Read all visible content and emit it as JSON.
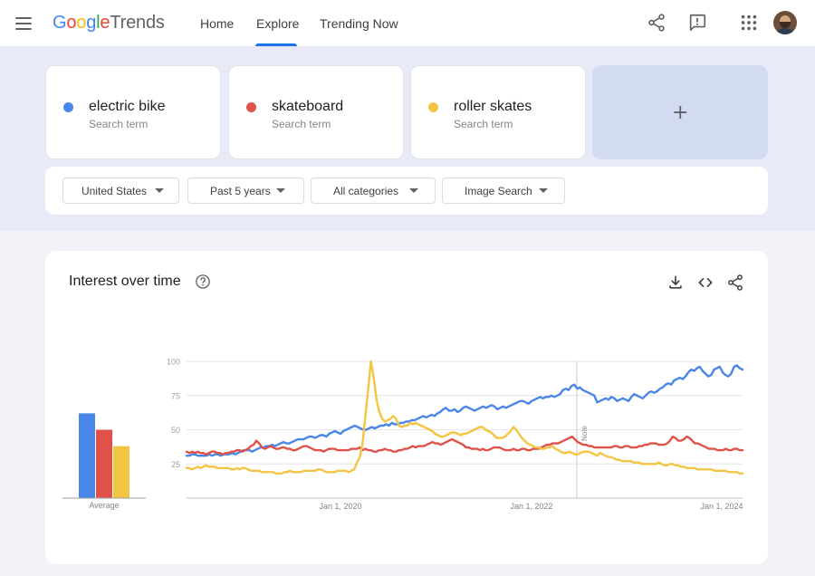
{
  "header": {
    "logo": {
      "g": "G",
      "o1": "o",
      "o2": "o",
      "g2": "g",
      "l": "l",
      "e": "e",
      "trends": "Trends"
    },
    "nav": [
      "Home",
      "Explore",
      "Trending Now"
    ],
    "active_tab": "Explore",
    "icons": [
      "menu-icon",
      "share-icon",
      "feedback-icon",
      "apps-grid-icon",
      "avatar"
    ]
  },
  "terms": [
    {
      "name": "electric bike",
      "sub": "Search term",
      "color": "#4a86e8"
    },
    {
      "name": "skateboard",
      "sub": "Search term",
      "color": "#e0514a"
    },
    {
      "name": "roller skates",
      "sub": "Search term",
      "color": "#f4c542"
    }
  ],
  "add_card": {
    "label": "+"
  },
  "filters": [
    "United States",
    "Past 5 years",
    "All categories",
    "Image Search"
  ],
  "main": {
    "title": "Interest over time",
    "icons": [
      "help-icon",
      "download-icon",
      "embed-code-icon",
      "share-icon"
    ]
  },
  "average": {
    "label": "Average",
    "values": [
      62,
      50,
      38
    ]
  },
  "chart_data": {
    "type": "line",
    "ylim": [
      0,
      100
    ],
    "y_ticks": [
      25,
      50,
      75,
      100
    ],
    "x_ticks": [
      "Jan 1, 2020",
      "Jan 1, 2022",
      "Jan 1, 2024"
    ],
    "note": "Note",
    "series": [
      {
        "name": "electric bike",
        "color": "#4a86e8",
        "values": [
          31,
          31,
          32,
          32,
          31,
          31,
          31,
          31,
          32,
          31,
          32,
          32,
          31,
          32,
          32,
          32,
          33,
          32,
          33,
          34,
          35,
          35,
          35,
          34,
          35,
          36,
          37,
          37,
          38,
          38,
          39,
          38,
          39,
          40,
          41,
          40,
          40,
          41,
          42,
          43,
          43,
          43,
          44,
          45,
          45,
          44,
          45,
          46,
          46,
          45,
          47,
          48,
          49,
          48,
          47,
          49,
          50,
          51,
          52,
          53,
          52,
          51,
          50,
          50,
          51,
          52,
          51,
          52,
          53,
          53,
          54,
          53,
          55,
          54,
          54,
          55,
          55,
          56,
          56,
          57,
          57,
          58,
          59,
          60,
          59,
          60,
          61,
          60,
          62,
          63,
          65,
          66,
          64,
          64,
          65,
          63,
          64,
          66,
          67,
          66,
          65,
          64,
          65,
          66,
          67,
          66,
          67,
          68,
          67,
          65,
          66,
          67,
          66,
          67,
          68,
          69,
          70,
          71,
          71,
          70,
          69,
          71,
          72,
          73,
          74,
          73,
          74,
          74,
          75,
          74,
          75,
          76,
          79,
          80,
          79,
          82,
          83,
          80,
          81,
          79,
          78,
          77,
          76,
          75,
          70,
          71,
          72,
          73,
          72,
          74,
          73,
          71,
          72,
          73,
          72,
          71,
          74,
          76,
          75,
          74,
          73,
          75,
          77,
          78,
          77,
          78,
          80,
          81,
          83,
          84,
          83,
          86,
          87,
          88,
          87,
          89,
          92,
          94,
          93,
          95,
          96,
          93,
          91,
          89,
          90,
          94,
          95,
          96,
          92,
          90,
          89,
          91,
          96,
          97,
          95,
          94
        ]
      },
      {
        "name": "skateboard",
        "color": "#e0514a",
        "values": [
          34,
          33,
          34,
          33,
          34,
          33,
          33,
          32,
          33,
          34,
          34,
          33,
          33,
          32,
          33,
          33,
          34,
          34,
          35,
          35,
          34,
          35,
          36,
          38,
          39,
          42,
          40,
          37,
          36,
          37,
          38,
          37,
          36,
          36,
          37,
          37,
          36,
          36,
          35,
          35,
          36,
          37,
          38,
          38,
          37,
          36,
          35,
          35,
          35,
          34,
          35,
          36,
          36,
          36,
          35,
          35,
          35,
          35,
          35,
          36,
          36,
          36,
          37,
          35,
          36,
          35,
          35,
          34,
          34,
          35,
          35,
          36,
          35,
          35,
          34,
          34,
          35,
          35,
          36,
          36,
          37,
          38,
          37,
          38,
          38,
          38,
          39,
          40,
          41,
          40,
          40,
          39,
          40,
          41,
          42,
          43,
          42,
          41,
          40,
          39,
          37,
          37,
          36,
          36,
          36,
          35,
          36,
          35,
          35,
          36,
          37,
          37,
          37,
          36,
          35,
          35,
          35,
          36,
          35,
          35,
          36,
          36,
          35,
          35,
          36,
          36,
          36,
          37,
          38,
          39,
          39,
          40,
          40,
          40,
          41,
          42,
          43,
          44,
          45,
          43,
          41,
          40,
          39,
          39,
          38,
          38,
          37,
          37,
          37,
          37,
          37,
          37,
          37,
          38,
          38,
          37,
          37,
          38,
          38,
          37,
          37,
          37,
          38,
          38,
          39,
          39,
          40,
          40,
          40,
          39,
          39,
          39,
          40,
          42,
          45,
          44,
          42,
          42,
          43,
          45,
          44,
          42,
          40,
          40,
          39,
          38,
          37,
          36,
          36,
          36,
          35,
          35,
          35,
          36,
          35,
          35,
          36,
          36,
          35,
          35
        ]
      },
      {
        "name": "roller skates",
        "color": "#f4c542",
        "values": [
          22,
          22,
          21,
          22,
          23,
          22,
          23,
          24,
          23,
          23,
          23,
          22,
          22,
          22,
          22,
          22,
          21,
          21,
          22,
          21,
          22,
          22,
          21,
          20,
          20,
          20,
          20,
          19,
          19,
          19,
          19,
          19,
          18,
          18,
          18,
          19,
          19,
          20,
          19,
          19,
          19,
          19,
          20,
          20,
          20,
          20,
          20,
          21,
          21,
          20,
          19,
          19,
          19,
          19,
          20,
          20,
          20,
          20,
          19,
          20,
          21,
          26,
          30,
          40,
          60,
          80,
          100,
          88,
          72,
          63,
          58,
          56,
          57,
          58,
          60,
          58,
          53,
          52,
          53,
          53,
          55,
          54,
          55,
          54,
          53,
          52,
          51,
          50,
          49,
          47,
          46,
          45,
          45,
          46,
          47,
          48,
          48,
          47,
          46,
          47,
          47,
          48,
          49,
          50,
          51,
          52,
          52,
          50,
          49,
          48,
          46,
          44,
          44,
          44,
          45,
          47,
          49,
          52,
          50,
          47,
          44,
          42,
          40,
          39,
          38,
          37,
          37,
          36,
          36,
          37,
          37,
          38,
          36,
          35,
          34,
          33,
          33,
          34,
          33,
          32,
          32,
          33,
          34,
          34,
          34,
          33,
          32,
          31,
          33,
          32,
          31,
          30,
          30,
          29,
          28,
          28,
          27,
          27,
          27,
          27,
          26,
          26,
          26,
          25,
          25,
          25,
          25,
          25,
          25,
          26,
          25,
          24,
          24,
          25,
          25,
          24,
          24,
          23,
          23,
          22,
          22,
          22,
          22,
          21,
          21,
          21,
          21,
          21,
          21,
          20,
          20,
          20,
          20,
          20,
          19,
          19,
          19,
          19,
          18,
          18
        ]
      }
    ]
  }
}
